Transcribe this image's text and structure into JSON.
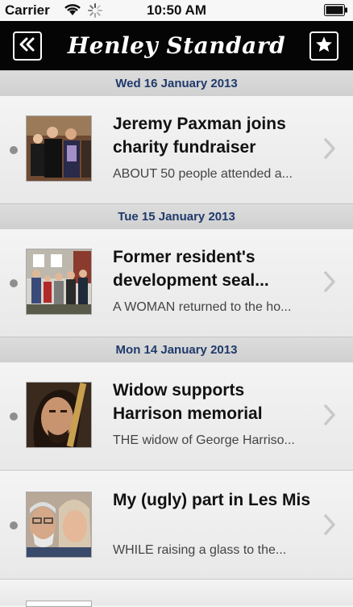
{
  "status": {
    "carrier": "Carrier",
    "time": "10:50 AM"
  },
  "nav": {
    "title": "Henley Standard",
    "back_icon": "double-chevron-left-icon",
    "fav_icon": "star-icon"
  },
  "sections": [
    {
      "date": "Wed 16 January 2013",
      "articles": [
        {
          "title": "Jeremy Paxman joins charity fundraiser",
          "snippet": "ABOUT 50 people attended a..."
        }
      ]
    },
    {
      "date": "Tue 15 January 2013",
      "articles": [
        {
          "title": "Former resident's development seal...",
          "snippet": "A WOMAN returned to the ho..."
        }
      ]
    },
    {
      "date": "Mon 14 January 2013",
      "articles": [
        {
          "title": "Widow supports Harrison memorial",
          "snippet": "THE widow of George Harriso..."
        },
        {
          "title": "My (ugly) part in Les Mis",
          "snippet": "WHILE raising a glass to the..."
        }
      ]
    }
  ]
}
